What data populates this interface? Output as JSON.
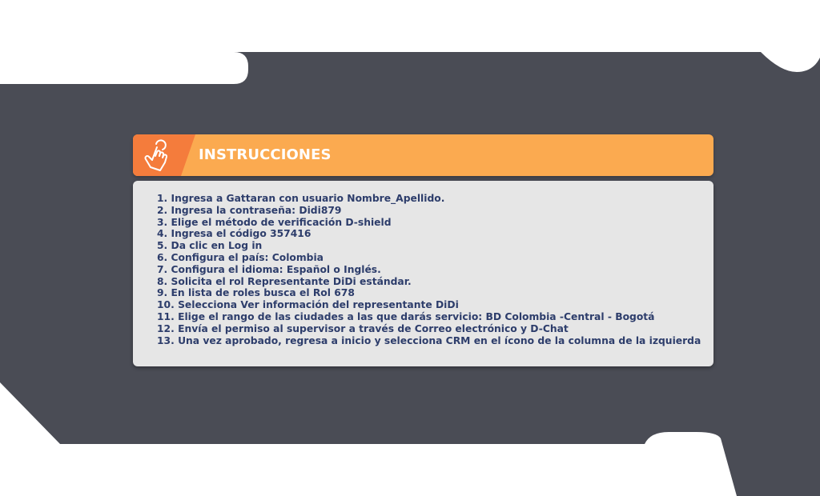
{
  "colors": {
    "background": "#ffffff",
    "dark_panel": "#4a4c55",
    "accent_orange": "#fbaa50",
    "accent_dark_orange": "#f47c3c",
    "card_body": "#e6e6e6",
    "text_navy": "#2d3d6b"
  },
  "header": {
    "icon": "hand-pointer-icon",
    "title": "INSTRUCCIONES"
  },
  "steps": [
    "1.  Ingresa a Gattaran con usuario Nombre_Apellido.",
    "2.  Ingresa la contraseña: Didi879",
    "3.  Elige el método de verificación D-shield",
    "4.  Ingresa el código 357416",
    "5.  Da clic en Log in",
    "6.  Configura el país: Colombia",
    "7.  Configura el idioma: Español o Inglés.",
    "8.  Solicita el rol Representante DiDi estándar.",
    "9.  En lista de roles busca el Rol 678",
    "10.  Selecciona Ver información del representante DiDi",
    "11.  Elige el rango de las ciudades a las que darás servicio:  BD Colombia -Central - Bogotá",
    "12.  Envía el permiso al supervisor a través de Correo electrónico y D-Chat",
    "13.  Una vez aprobado, regresa a inicio y selecciona CRM en el ícono de la columna de la izquierda"
  ]
}
